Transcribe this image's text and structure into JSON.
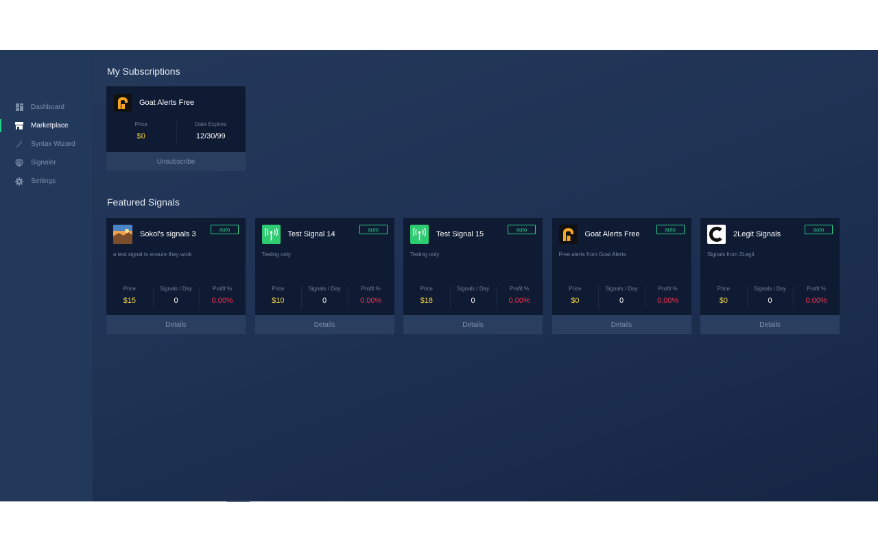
{
  "sidebar": {
    "items": [
      {
        "label": "Dashboard",
        "icon": "dashboard-icon",
        "active": false
      },
      {
        "label": "Marketplace",
        "icon": "store-icon",
        "active": true
      },
      {
        "label": "Syntax Wizard",
        "icon": "magic-wand-icon",
        "active": false
      },
      {
        "label": "Signaler",
        "icon": "broadcast-icon",
        "active": false
      },
      {
        "label": "Settings",
        "icon": "gear-icon",
        "active": false
      }
    ]
  },
  "subscriptions": {
    "title": "My Subscriptions",
    "items": [
      {
        "name": "Goat Alerts Free",
        "avatar": "goat-alerts-logo",
        "price_label": "Price",
        "price": "$0",
        "expires_label": "Date Expires",
        "expires": "12/30/99",
        "action": "Unsubscribe"
      }
    ]
  },
  "featured": {
    "title": "Featured Signals",
    "labels": {
      "price": "Price",
      "signals_per_day": "Signals / Day",
      "profit": "Profit %",
      "details": "Details"
    },
    "items": [
      {
        "name": "Sokol's signals 3",
        "badge": "auto",
        "description": "a test signal to ensure they work",
        "price": "$15",
        "signals_per_day": "0",
        "profit": "0.00%",
        "avatar": "landscape-photo"
      },
      {
        "name": "Test Signal 14",
        "badge": "auto",
        "description": "Testing only",
        "price": "$10",
        "signals_per_day": "0",
        "profit": "0.00%",
        "avatar": "antenna-icon"
      },
      {
        "name": "Test Signal 15",
        "badge": "auto",
        "description": "Testing only",
        "price": "$18",
        "signals_per_day": "0",
        "profit": "0.00%",
        "avatar": "antenna-icon"
      },
      {
        "name": "Goat Alerts Free",
        "badge": "auto",
        "description": "Free alerts from Goat Alerts",
        "price": "$0",
        "signals_per_day": "0",
        "profit": "0.00%",
        "avatar": "goat-alerts-logo"
      },
      {
        "name": "2Legit Signals",
        "badge": "auto",
        "description": "Signals from 2Legit",
        "price": "$0",
        "signals_per_day": "0",
        "profit": "0.00%",
        "avatar": "2legit-logo"
      }
    ]
  },
  "colors": {
    "accent": "#2ad18a",
    "price": "#f3d24a",
    "profit": "#f2304f",
    "card": "#0f1b33",
    "footer": "#2a3e60"
  }
}
